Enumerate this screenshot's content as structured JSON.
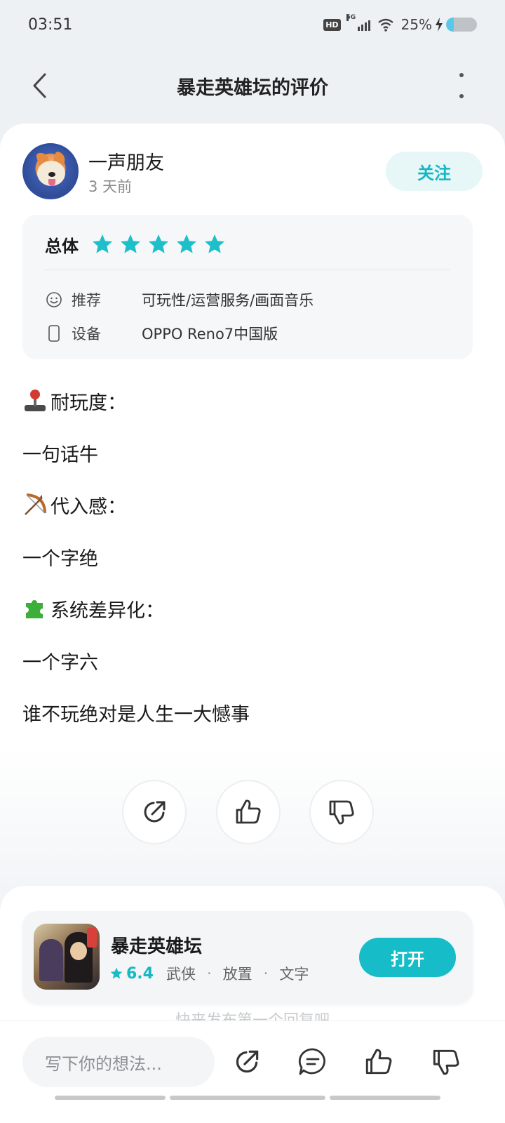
{
  "status_bar": {
    "time": "03:51",
    "hd": "HD",
    "network": "5G",
    "battery_text": "25%",
    "battery_level": 0.25
  },
  "nav": {
    "title": "暴走英雄坛的评价"
  },
  "review": {
    "author": "一声朋友",
    "time_ago": "3 天前",
    "follow_label": "关注",
    "overall_label": "总体",
    "stars": 5,
    "star_color": "#1fbfca",
    "recommend_label": "推荐",
    "recommend_value": "可玩性/运营服务/画面音乐",
    "device_label": "设备",
    "device_value": "OPPO Reno7中国版",
    "paragraphs": [
      {
        "emoji": "joystick-icon",
        "text": "耐玩度："
      },
      {
        "emoji": "",
        "text": "一句话牛"
      },
      {
        "emoji": "bow-arrow-icon",
        "text": "代入感："
      },
      {
        "emoji": "",
        "text": "一个字绝"
      },
      {
        "emoji": "puzzle-icon",
        "text": "系统差异化："
      },
      {
        "emoji": "",
        "text": "一个字六"
      },
      {
        "emoji": "",
        "text": "谁不玩绝对是人生一大憾事"
      }
    ]
  },
  "app_card": {
    "name": "暴走英雄坛",
    "score": "6.4",
    "tags": [
      "武侠",
      "放置",
      "文字"
    ],
    "open_label": "打开",
    "accent": "#16bcc7"
  },
  "comments": {
    "hint": "快来发布第一个回复吧"
  },
  "bottom_bar": {
    "input_placeholder": "写下你的想法..."
  }
}
